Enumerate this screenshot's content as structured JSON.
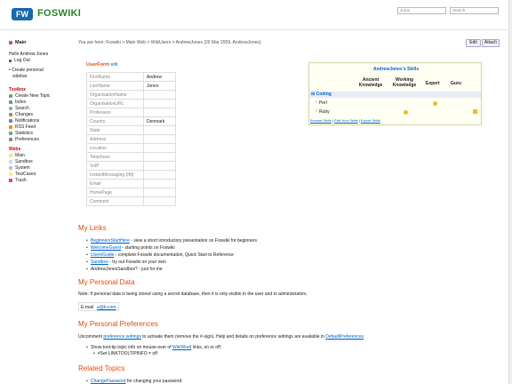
{
  "header": {
    "logo_box": "FW",
    "logo_text": "FOSWIKI",
    "jump_placeholder": "Jump",
    "search_placeholder": "Search"
  },
  "sidebar": {
    "main_label": "Main",
    "hello": "Hello Andrew Jones",
    "logout": "Log Out",
    "create_personal": "Create personal",
    "create_personal2": "sidebar",
    "toolbox_head": "Toolbox",
    "toolbox": [
      "Create New Topic",
      "Index",
      "Search",
      "Changes",
      "Notifications",
      "RSS Feed",
      "Statistics",
      "Preferences"
    ],
    "webs_head": "Webs",
    "webs": [
      "Main",
      "Sandbox",
      "System",
      "TestCases",
      "Trash"
    ]
  },
  "breadcrumb": {
    "prefix": "You are here:",
    "items": [
      "Foswiki",
      "Main Web",
      "WikiUsers"
    ],
    "current": "AndrewJones (20 Mar 2009, AndrewJones)",
    "sep": ">"
  },
  "toolbar": {
    "edit_label": "Edit",
    "attach_label": "Attach"
  },
  "userform": {
    "title": "UserForm",
    "edit": "edit",
    "rows": [
      {
        "label": "FirstName",
        "value": "Andrew"
      },
      {
        "label": "LastName",
        "value": "Jones"
      },
      {
        "label": "OrganisationName",
        "value": ""
      },
      {
        "label": "OrganisationURL",
        "value": ""
      },
      {
        "label": "Profession",
        "value": ""
      },
      {
        "label": "Country",
        "value": "Denmark"
      },
      {
        "label": "State",
        "value": ""
      },
      {
        "label": "Address",
        "value": ""
      },
      {
        "label": "Location",
        "value": ""
      },
      {
        "label": "Telephone",
        "value": ""
      },
      {
        "label": "VoIP",
        "value": ""
      },
      {
        "label": "InstantMessaging (IM)",
        "value": ""
      },
      {
        "label": "Email",
        "value": ""
      },
      {
        "label": "HomePage",
        "value": ""
      },
      {
        "label": "Comment",
        "value": ""
      }
    ]
  },
  "skills": {
    "title": "AndrewJones's Skills",
    "col1a": "Ancient",
    "col1b": "Knowledge",
    "col2a": "Working",
    "col2b": "Knowledge",
    "col3": "Expert",
    "col4": "Guru",
    "category": "Coding",
    "items": [
      "Perl",
      "Ruby"
    ],
    "footer": [
      "Browse Skills",
      "Edit Your Skills",
      "Export Skills"
    ]
  },
  "mylinks": {
    "heading": "My Links",
    "items": [
      {
        "link": "BeginnersStartHere",
        "text": " - view a short introductory presentation on Foswiki for beginners"
      },
      {
        "link": "WelcomeGuest",
        "text": " - starting points on Foswiki"
      },
      {
        "link": "UsersGuide",
        "text": " - complete Foswiki documentation, Quick Start to Reference"
      },
      {
        "link": "Sandbox",
        "text": " - try out Foswiki on your own"
      },
      {
        "link": "",
        "text": "AndrewJonesSandbox? - just for me"
      }
    ]
  },
  "personal": {
    "heading": "My Personal Data",
    "note": "Note: If personal data is being stored using a secret database, then it is only visible to the user and to administrators.",
    "email_label": "E-mail",
    "email_value": "a@b.com"
  },
  "prefs": {
    "heading": "My Personal Preferences",
    "line_a": "Uncomment ",
    "line_link": "preference settings",
    "line_b": " to activate them (remove the #-sign). Help and details on preference settings are available in ",
    "line_link2": "DefaultPreferences",
    "item_a": "Show tool-tip topic info on mouse-over of ",
    "item_link": "WikiWord",
    "item_b": " links, on or off:",
    "sub": "#Set LINKTOOLTIPINFO = off"
  },
  "related": {
    "heading": "Related Topics",
    "item_link": "ChangePassword",
    "item_text": " for changing your password"
  },
  "colors": {
    "accent": "#e05010",
    "link": "#0066cc",
    "logo": "#1a6aa8",
    "logo_text": "#2a8a2a",
    "sidebar_head": "#cc0000"
  }
}
